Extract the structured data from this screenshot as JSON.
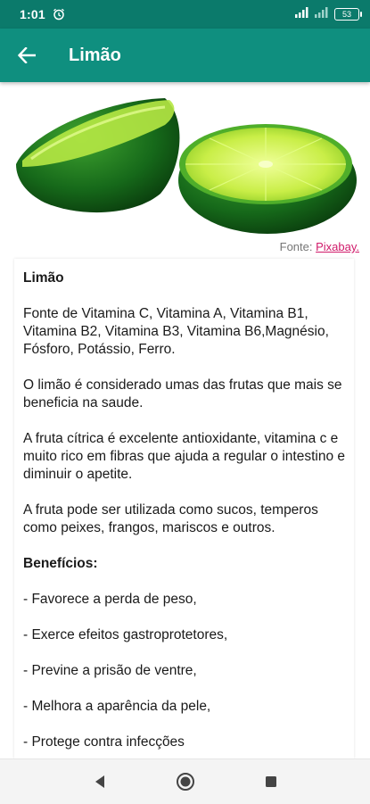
{
  "status_bar": {
    "time": "1:01",
    "battery": "53"
  },
  "app_bar": {
    "title": "Limão"
  },
  "image_source": {
    "prefix": "Fonte: ",
    "link": "Pixabay."
  },
  "article": {
    "heading": "Limão",
    "paragraphs": [
      "Fonte de Vitamina C, Vitamina A, Vitamina B1, Vitamina B2, Vitamina B3, Vitamina B6,Magnésio, Fósforo, Potássio, Ferro.",
      "O limão é considerado umas das frutas que mais se beneficia na saude.",
      "A fruta cítrica é excelente antioxidante, vitamina c e muito rico em fibras que ajuda a regular o intestino e diminuir o apetite.",
      "A fruta pode ser utilizada como sucos, temperos como peixes, frangos, mariscos e outros."
    ],
    "benefits_heading": "Benefícios:",
    "benefits": [
      "- Favorece a perda de peso,",
      "- Exerce efeitos gastroprotetores,",
      "- Previne a prisão de ventre,",
      "- Melhora a aparência da pele,",
      "- Protege contra infecções"
    ]
  },
  "colors": {
    "status_bar": "#0b7a6b",
    "app_bar": "#0f8f7f",
    "link": "#d01a6a"
  },
  "icons": {
    "back": "arrow-left-icon",
    "nav_back": "triangle-back-icon",
    "nav_home": "circle-home-icon",
    "nav_recents": "square-recents-icon"
  }
}
